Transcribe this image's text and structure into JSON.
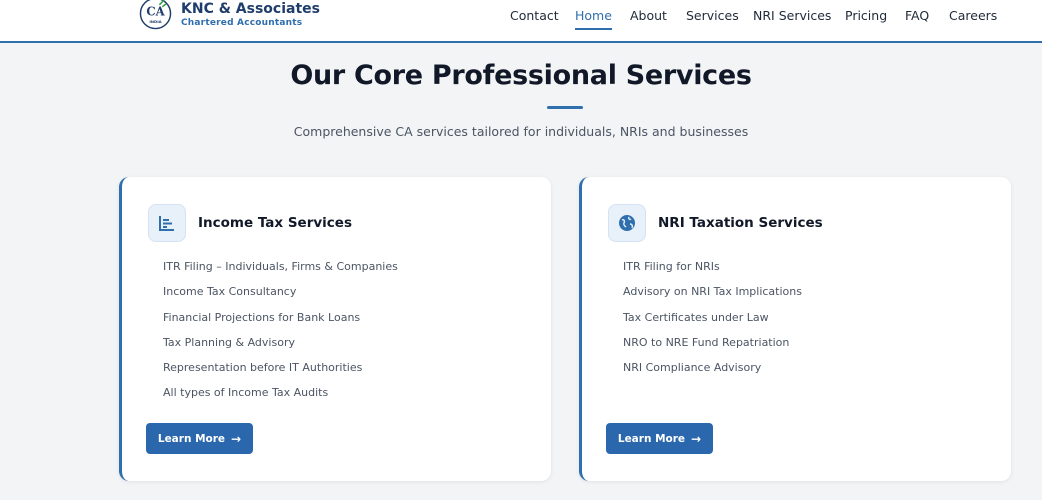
{
  "brand": {
    "logo_text": "CA",
    "logo_sub": "INDIA",
    "name": "KNC & Associates",
    "tagline": "Chartered Accountants"
  },
  "nav": {
    "items": [
      {
        "label": "Contact"
      },
      {
        "label": "Home",
        "active": true
      },
      {
        "label": "About"
      },
      {
        "label": "Services"
      },
      {
        "label": "NRI Services"
      },
      {
        "label": "Pricing"
      },
      {
        "label": "FAQ"
      },
      {
        "label": "Careers"
      }
    ]
  },
  "section": {
    "title": "Our Core Professional Services",
    "subtitle": "Comprehensive CA services tailored for individuals, NRIs and businesses"
  },
  "cards": [
    {
      "icon": "bar-chart-icon",
      "title": "Income Tax Services",
      "items": [
        "ITR Filing – Individuals, Firms & Companies",
        "Income Tax Consultancy",
        "Financial Projections for Bank Loans",
        "Tax Planning & Advisory",
        "Representation before IT Authorities",
        "All types of Income Tax Audits"
      ],
      "button": "Learn More"
    },
    {
      "icon": "globe-icon",
      "title": "NRI Taxation Services",
      "items": [
        "ITR Filing for NRIs",
        "Advisory on NRI Tax Implications",
        "Tax Certificates under Law",
        "NRO to NRE Fund Repatriation",
        "NRI Compliance Advisory"
      ],
      "button": "Learn More"
    }
  ],
  "colors": {
    "accent": "#2f6fae",
    "button": "#2a67ad",
    "background": "#f3f4f6"
  }
}
